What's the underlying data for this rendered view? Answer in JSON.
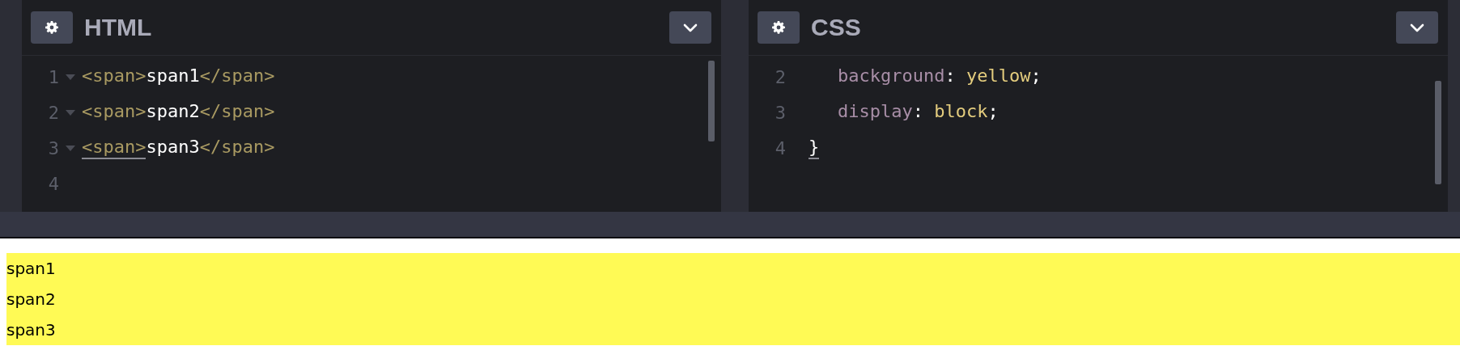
{
  "panels": [
    {
      "title": "HTML",
      "lines": [
        {
          "number": "1",
          "foldable": true,
          "indented": false,
          "tokens": [
            {
              "text": "<span>",
              "kind": "tag",
              "underlined": false
            },
            {
              "text": "span1",
              "kind": "text",
              "underlined": false
            },
            {
              "text": "</span>",
              "kind": "tag",
              "underlined": false
            }
          ]
        },
        {
          "number": "2",
          "foldable": true,
          "indented": false,
          "tokens": [
            {
              "text": "<span>",
              "kind": "tag",
              "underlined": false
            },
            {
              "text": "span2",
              "kind": "text",
              "underlined": false
            },
            {
              "text": "</span>",
              "kind": "tag",
              "underlined": false
            }
          ]
        },
        {
          "number": "3",
          "foldable": true,
          "indented": false,
          "tokens": [
            {
              "text": "<span>",
              "kind": "tag",
              "underlined": true
            },
            {
              "text": "span3",
              "kind": "text",
              "underlined": false
            },
            {
              "text": "</span>",
              "kind": "tag",
              "underlined": false
            }
          ]
        },
        {
          "number": "4",
          "foldable": false
        }
      ]
    },
    {
      "title": "CSS",
      "lines": [
        {
          "number": "2",
          "foldable": false,
          "indented": true,
          "tokens": [
            {
              "text": "background",
              "kind": "property",
              "underlined": false
            },
            {
              "text": ": ",
              "kind": "punct",
              "underlined": false
            },
            {
              "text": "yellow",
              "kind": "value",
              "underlined": false
            },
            {
              "text": ";",
              "kind": "punct",
              "underlined": false
            }
          ]
        },
        {
          "number": "3",
          "foldable": false,
          "indented": true,
          "tokens": [
            {
              "text": "display",
              "kind": "property",
              "underlined": false
            },
            {
              "text": ": ",
              "kind": "punct",
              "underlined": false
            },
            {
              "text": "block",
              "kind": "value",
              "underlined": false
            },
            {
              "text": ";",
              "kind": "punct",
              "underlined": false
            }
          ]
        },
        {
          "number": "4",
          "foldable": false,
          "indented": false,
          "tokens": [
            {
              "text": "}",
              "kind": "punct",
              "underlined": true
            }
          ]
        }
      ]
    }
  ],
  "output": {
    "lines": [
      "span1",
      "span2",
      "span3"
    ]
  }
}
